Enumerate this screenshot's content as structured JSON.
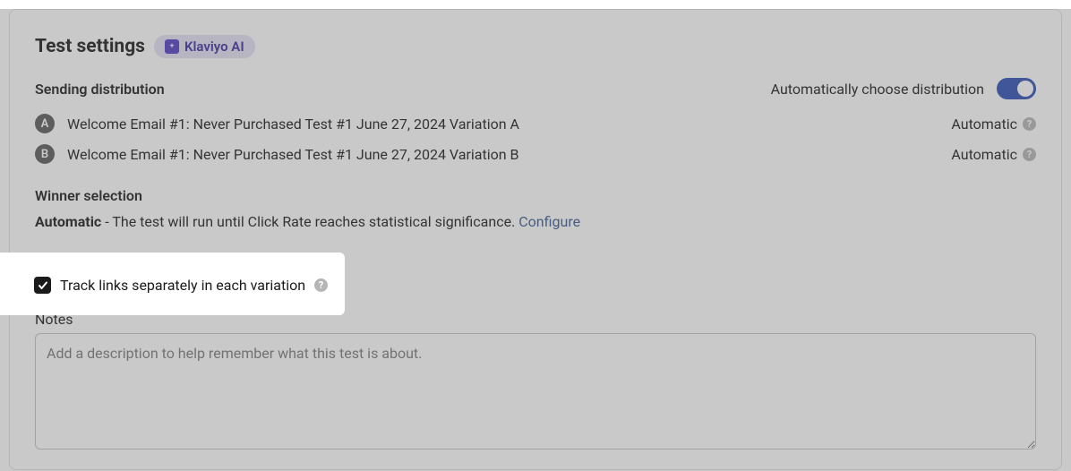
{
  "header": {
    "title": "Test settings",
    "ai_badge": "Klaviyo AI"
  },
  "distribution": {
    "section_label": "Sending distribution",
    "auto_label": "Automatically choose distribution",
    "toggle_on": true,
    "variations": [
      {
        "badge": "A",
        "name": "Welcome Email #1: Never Purchased Test #1 June 27, 2024 Variation A",
        "status": "Automatic"
      },
      {
        "badge": "B",
        "name": "Welcome Email #1: Never Purchased Test #1 June 27, 2024 Variation B",
        "status": "Automatic"
      }
    ]
  },
  "winner": {
    "section_label": "Winner selection",
    "mode": "Automatic",
    "desc_rest": " - The test will run until Click Rate reaches statistical significance. ",
    "configure": "Configure"
  },
  "track_links": {
    "label": "Track links separately in each variation",
    "checked": true
  },
  "notes": {
    "label": "Notes",
    "placeholder": "Add a description to help remember what this test is about.",
    "value": ""
  }
}
